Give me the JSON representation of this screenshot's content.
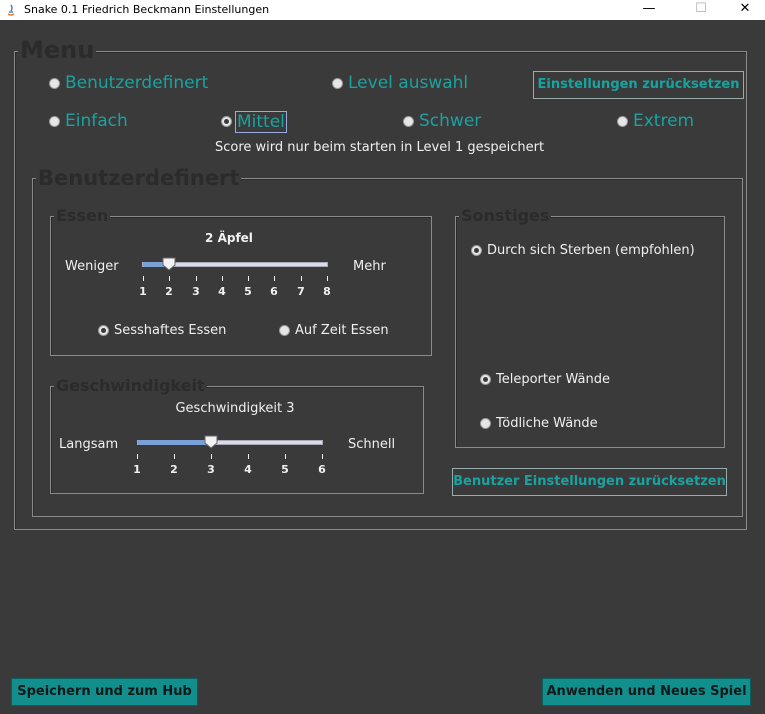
{
  "window": {
    "title": "Snake 0.1 Friedrich Beckmann Einstellungen",
    "minimize": "—",
    "maximize": "☐",
    "close": "✕"
  },
  "menu": {
    "title": "Menu",
    "benutzerdefiniert": "Benutzerdefinert",
    "level_auswahl": "Level auswahl",
    "reset_settings": "Einstellungen zurücksetzen",
    "einfach": "Einfach",
    "mittel": "Mittel",
    "schwer": "Schwer",
    "extrem": "Extrem",
    "score_note": "Score wird nur beim starten in Level 1 gespeichert",
    "selected_difficulty": "Mittel"
  },
  "custom": {
    "title": "Benutzerdefinert",
    "essen": {
      "title": "Essen",
      "value_label": "2 Äpfel",
      "min_label": "Weniger",
      "max_label": "Mehr",
      "ticks": [
        "1",
        "2",
        "3",
        "4",
        "5",
        "6",
        "7",
        "8"
      ],
      "value": 2,
      "min": 1,
      "max": 8,
      "sesshaft": "Sesshaftes Essen",
      "auf_zeit": "Auf Zeit Essen",
      "selected_mode": "Sesshaftes Essen"
    },
    "speed": {
      "title": "Geschwindigkeit",
      "value_label": "Geschwindigkeit 3",
      "min_label": "Langsam",
      "max_label": "Schnell",
      "ticks": [
        "1",
        "2",
        "3",
        "4",
        "5",
        "6"
      ],
      "value": 3,
      "min": 1,
      "max": 6
    },
    "sonstiges": {
      "title": "Sonstiges",
      "self_death": "Durch sich Sterben (empfohlen)",
      "teleport_walls": "Teleporter Wände",
      "deadly_walls": "Tödliche Wände",
      "self_death_selected": true,
      "walls_selected": "Teleporter Wände"
    },
    "reset_custom": "Benutzer Einstellungen zurücksetzen"
  },
  "footer": {
    "save_hub": "Speichern und zum Hub",
    "apply_new": "Anwenden und Neues Spiel"
  }
}
